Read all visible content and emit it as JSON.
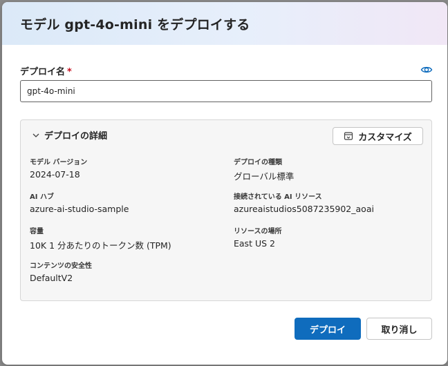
{
  "dialog": {
    "title": "モデル gpt-4o-mini をデプロイする"
  },
  "deployment_name": {
    "label": "デプロイ名",
    "required_mark": "*",
    "value": "gpt-4o-mini",
    "icon": "eye-icon"
  },
  "details": {
    "title": "デプロイの詳細",
    "customize_label": "カスタマイズ",
    "properties": {
      "model_version": {
        "label": "モデル バージョン",
        "value": "2024-07-18"
      },
      "deployment_type": {
        "label": "デプロイの種類",
        "value": "グローバル標準"
      },
      "ai_hub": {
        "label": "AI ハブ",
        "value": "azure-ai-studio-sample"
      },
      "ai_resource": {
        "label": "接続されている AI リソース",
        "value": "azureaistudios5087235902_aoai"
      },
      "capacity": {
        "label": "容量",
        "value": "10K 1 分あたりのトークン数 (TPM)"
      },
      "resource_location": {
        "label": "リソースの場所",
        "value": "East US 2"
      },
      "content_safety": {
        "label": "コンテンツの安全性",
        "value": "DefaultV2"
      }
    }
  },
  "actions": {
    "deploy_label": "デプロイ",
    "cancel_label": "取り消し"
  },
  "colors": {
    "primary": "#0f6cbd",
    "required": "#c50f1f"
  }
}
